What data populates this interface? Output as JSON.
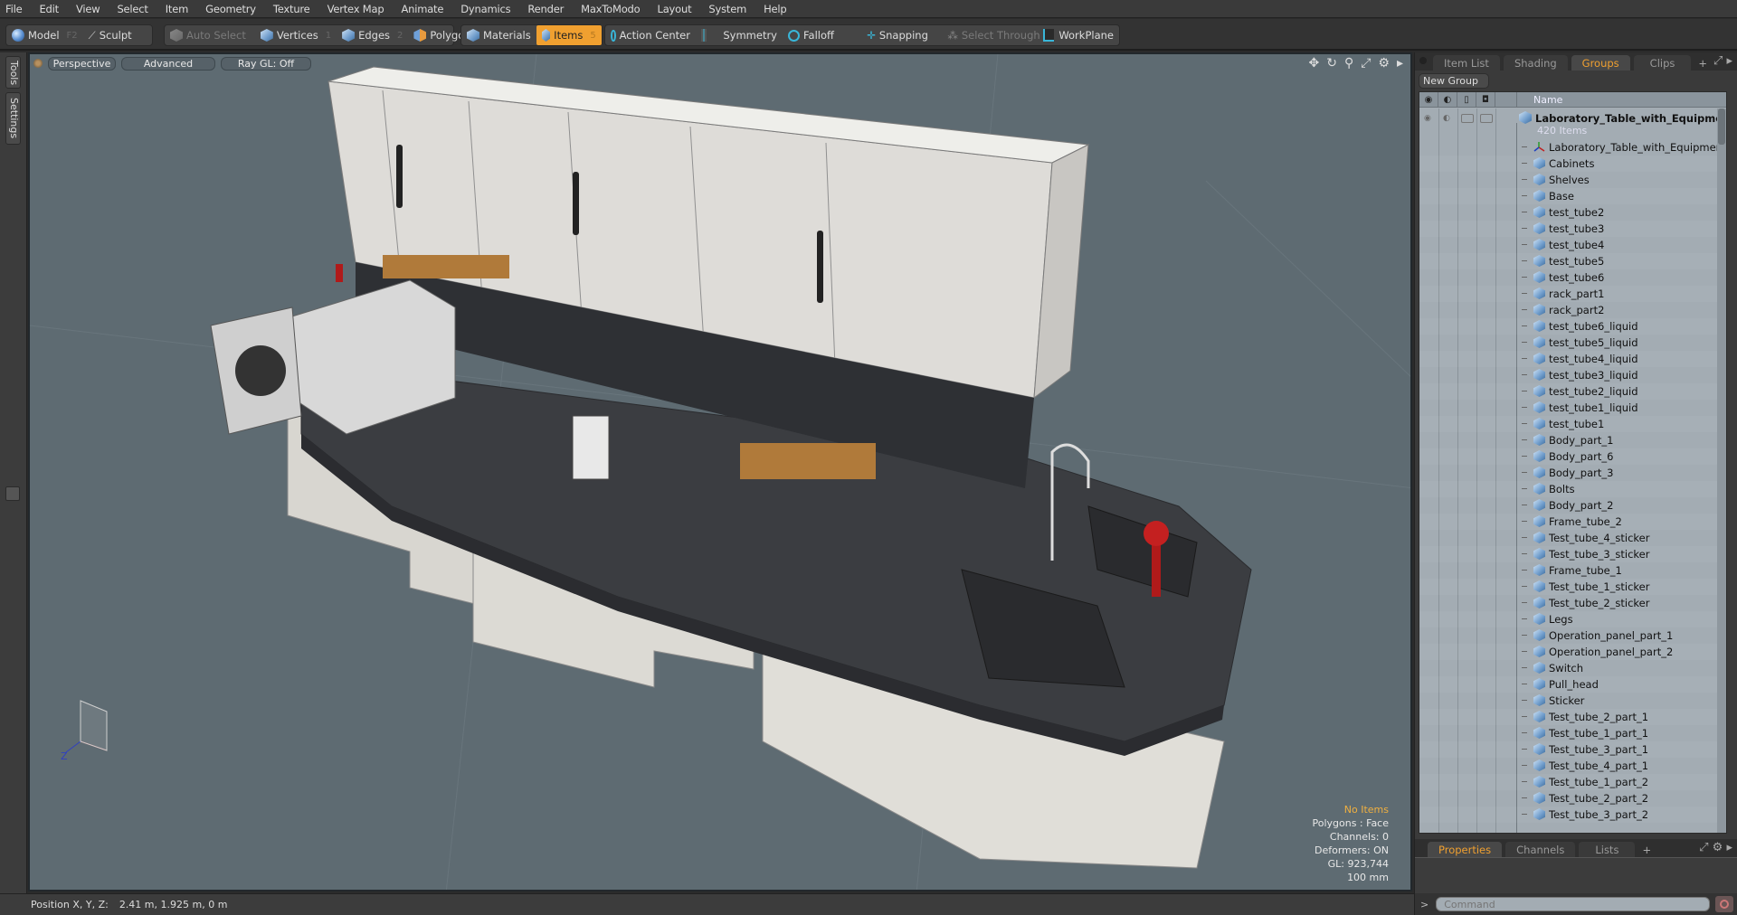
{
  "menu": [
    "File",
    "Edit",
    "View",
    "Select",
    "Item",
    "Geometry",
    "Texture",
    "Vertex Map",
    "Animate",
    "Dynamics",
    "Render",
    "MaxToModo",
    "Layout",
    "System",
    "Help"
  ],
  "toolbar": {
    "model": {
      "label": "Model",
      "key": "F2",
      "icon": "sphere-icon"
    },
    "sculpt": {
      "label": "Sculpt",
      "icon": "brush-icon"
    },
    "auto_select": {
      "label": "Auto Select",
      "icon": "cube-icon"
    },
    "vertices": {
      "label": "Vertices",
      "key": "1",
      "icon": "cube-icon"
    },
    "edges": {
      "label": "Edges",
      "key": "2",
      "icon": "cube-icon"
    },
    "polygons": {
      "label": "Polygons",
      "icon": "cube-icon"
    },
    "materials": {
      "label": "Materials",
      "icon": "cube-icon"
    },
    "items": {
      "label": "Items",
      "key": "5",
      "icon": "cube-icon",
      "active": true
    },
    "action_center": {
      "label": "Action Center",
      "icon": "crosshair-icon"
    },
    "symmetry": {
      "label": "Symmetry",
      "icon": "symmetry-icon"
    },
    "falloff": {
      "label": "Falloff",
      "icon": "target-icon"
    },
    "snapping": {
      "label": "Snapping",
      "icon": "snap-icon"
    },
    "select_through": {
      "label": "Select Through",
      "icon": "select-through-icon"
    },
    "workplane": {
      "label": "WorkPlane",
      "icon": "workplane-icon"
    }
  },
  "left_tabs": {
    "tools": "Tools",
    "settings": "Settings"
  },
  "viewport": {
    "view_mode": "Perspective",
    "shading": "Advanced",
    "raygl": "Ray GL: Off",
    "icons": [
      "move-icon",
      "rotate-icon",
      "zoom-icon",
      "maximize-icon",
      "gear-icon",
      "arrow-right-icon"
    ],
    "info": {
      "selection": "No Items",
      "polygons": "Polygons : Face",
      "channels": "Channels: 0",
      "deformers": "Deformers: ON",
      "gl": "GL: 923,744",
      "scale": "100 mm"
    },
    "axis_label": "Z"
  },
  "status": {
    "position_label": "Position X, Y, Z:",
    "position_value": "2.41 m, 1.925 m, 0 m"
  },
  "right_panel": {
    "tabs": [
      {
        "label": "Item List",
        "active": false
      },
      {
        "label": "Shading",
        "active": false
      },
      {
        "label": "Groups",
        "active": true
      },
      {
        "label": "Clips",
        "active": false
      }
    ],
    "new_group": "New Group",
    "column_name": "Name",
    "root": {
      "name": "Laboratory_Table_with_Equipmen...",
      "count": "420 Items"
    },
    "items": [
      {
        "name": "Laboratory_Table_with_Equipment",
        "type": "locator"
      },
      {
        "name": "Cabinets",
        "type": "mesh"
      },
      {
        "name": "Shelves",
        "type": "mesh"
      },
      {
        "name": "Base",
        "type": "mesh"
      },
      {
        "name": "test_tube2",
        "type": "mesh"
      },
      {
        "name": "test_tube3",
        "type": "mesh"
      },
      {
        "name": "test_tube4",
        "type": "mesh"
      },
      {
        "name": "test_tube5",
        "type": "mesh"
      },
      {
        "name": "test_tube6",
        "type": "mesh"
      },
      {
        "name": "rack_part1",
        "type": "mesh"
      },
      {
        "name": "rack_part2",
        "type": "mesh"
      },
      {
        "name": "test_tube6_liquid",
        "type": "mesh"
      },
      {
        "name": "test_tube5_liquid",
        "type": "mesh"
      },
      {
        "name": "test_tube4_liquid",
        "type": "mesh"
      },
      {
        "name": "test_tube3_liquid",
        "type": "mesh"
      },
      {
        "name": "test_tube2_liquid",
        "type": "mesh"
      },
      {
        "name": "test_tube1_liquid",
        "type": "mesh"
      },
      {
        "name": "test_tube1",
        "type": "mesh"
      },
      {
        "name": "Body_part_1",
        "type": "mesh"
      },
      {
        "name": "Body_part_6",
        "type": "mesh"
      },
      {
        "name": "Body_part_3",
        "type": "mesh"
      },
      {
        "name": "Bolts",
        "type": "mesh"
      },
      {
        "name": "Body_part_2",
        "type": "mesh"
      },
      {
        "name": "Frame_tube_2",
        "type": "mesh"
      },
      {
        "name": "Test_tube_4_sticker",
        "type": "mesh"
      },
      {
        "name": "Test_tube_3_sticker",
        "type": "mesh"
      },
      {
        "name": "Frame_tube_1",
        "type": "mesh"
      },
      {
        "name": "Test_tube_1_sticker",
        "type": "mesh"
      },
      {
        "name": "Test_tube_2_sticker",
        "type": "mesh"
      },
      {
        "name": "Legs",
        "type": "mesh"
      },
      {
        "name": "Operation_panel_part_1",
        "type": "mesh"
      },
      {
        "name": "Operation_panel_part_2",
        "type": "mesh"
      },
      {
        "name": "Switch",
        "type": "mesh"
      },
      {
        "name": "Pull_head",
        "type": "mesh"
      },
      {
        "name": "Sticker",
        "type": "mesh"
      },
      {
        "name": "Test_tube_2_part_1",
        "type": "mesh"
      },
      {
        "name": "Test_tube_1_part_1",
        "type": "mesh"
      },
      {
        "name": "Test_tube_3_part_1",
        "type": "mesh"
      },
      {
        "name": "Test_tube_4_part_1",
        "type": "mesh"
      },
      {
        "name": "Test_tube_1_part_2",
        "type": "mesh"
      },
      {
        "name": "Test_tube_2_part_2",
        "type": "mesh"
      },
      {
        "name": "Test_tube_3_part_2",
        "type": "mesh"
      }
    ],
    "bottom_tabs": [
      {
        "label": "Properties",
        "active": true
      },
      {
        "label": "Channels",
        "active": false
      },
      {
        "label": "Lists",
        "active": false
      }
    ],
    "command_placeholder": "Command"
  },
  "colors": {
    "accent": "#f0a030",
    "viewport_bg": "#5e6b72",
    "tree_bg": "#a3acb3"
  }
}
